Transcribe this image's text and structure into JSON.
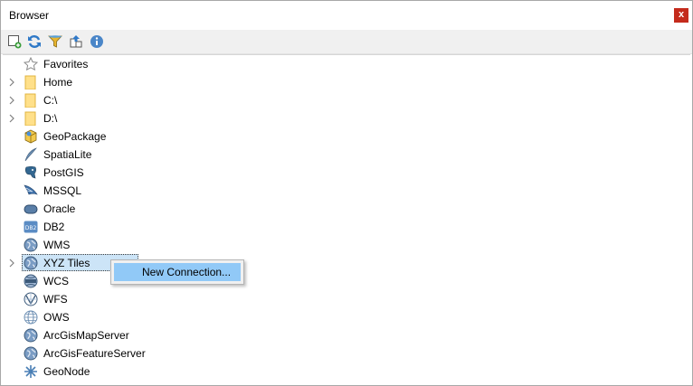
{
  "window": {
    "title": "Browser",
    "close_label": "x"
  },
  "toolbar": {
    "icons": [
      "add-layer-icon",
      "refresh-icon",
      "filter-icon",
      "collapse-all-icon",
      "info-icon"
    ]
  },
  "tree": {
    "items": [
      {
        "label": "Favorites",
        "icon": "star-icon",
        "expandable": false
      },
      {
        "label": "Home",
        "icon": "folder-icon",
        "expandable": true
      },
      {
        "label": "C:\\",
        "icon": "folder-icon",
        "expandable": true
      },
      {
        "label": "D:\\",
        "icon": "folder-icon",
        "expandable": true
      },
      {
        "label": "GeoPackage",
        "icon": "geopackage-icon",
        "expandable": false
      },
      {
        "label": "SpatiaLite",
        "icon": "spatialite-icon",
        "expandable": false
      },
      {
        "label": "PostGIS",
        "icon": "postgis-icon",
        "expandable": false
      },
      {
        "label": "MSSQL",
        "icon": "mssql-icon",
        "expandable": false
      },
      {
        "label": "Oracle",
        "icon": "oracle-icon",
        "expandable": false
      },
      {
        "label": "DB2",
        "icon": "db2-icon",
        "expandable": false
      },
      {
        "label": "WMS",
        "icon": "globe-icon",
        "expandable": false
      },
      {
        "label": "XYZ Tiles",
        "icon": "globe-icon",
        "expandable": true,
        "selected": true
      },
      {
        "label": "WCS",
        "icon": "wcs-globe-icon",
        "expandable": false
      },
      {
        "label": "WFS",
        "icon": "wfs-globe-icon",
        "expandable": false
      },
      {
        "label": "OWS",
        "icon": "ows-globe-icon",
        "expandable": false
      },
      {
        "label": "ArcGisMapServer",
        "icon": "arcgis-map-icon",
        "expandable": false
      },
      {
        "label": "ArcGisFeatureServer",
        "icon": "arcgis-feature-icon",
        "expandable": false
      },
      {
        "label": "GeoNode",
        "icon": "geonode-icon",
        "expandable": false
      }
    ]
  },
  "context_menu": {
    "items": [
      "New Connection..."
    ]
  },
  "colors": {
    "close": "#c42b1c",
    "highlight": "#91c9f7",
    "selection": "#cce4f7"
  }
}
